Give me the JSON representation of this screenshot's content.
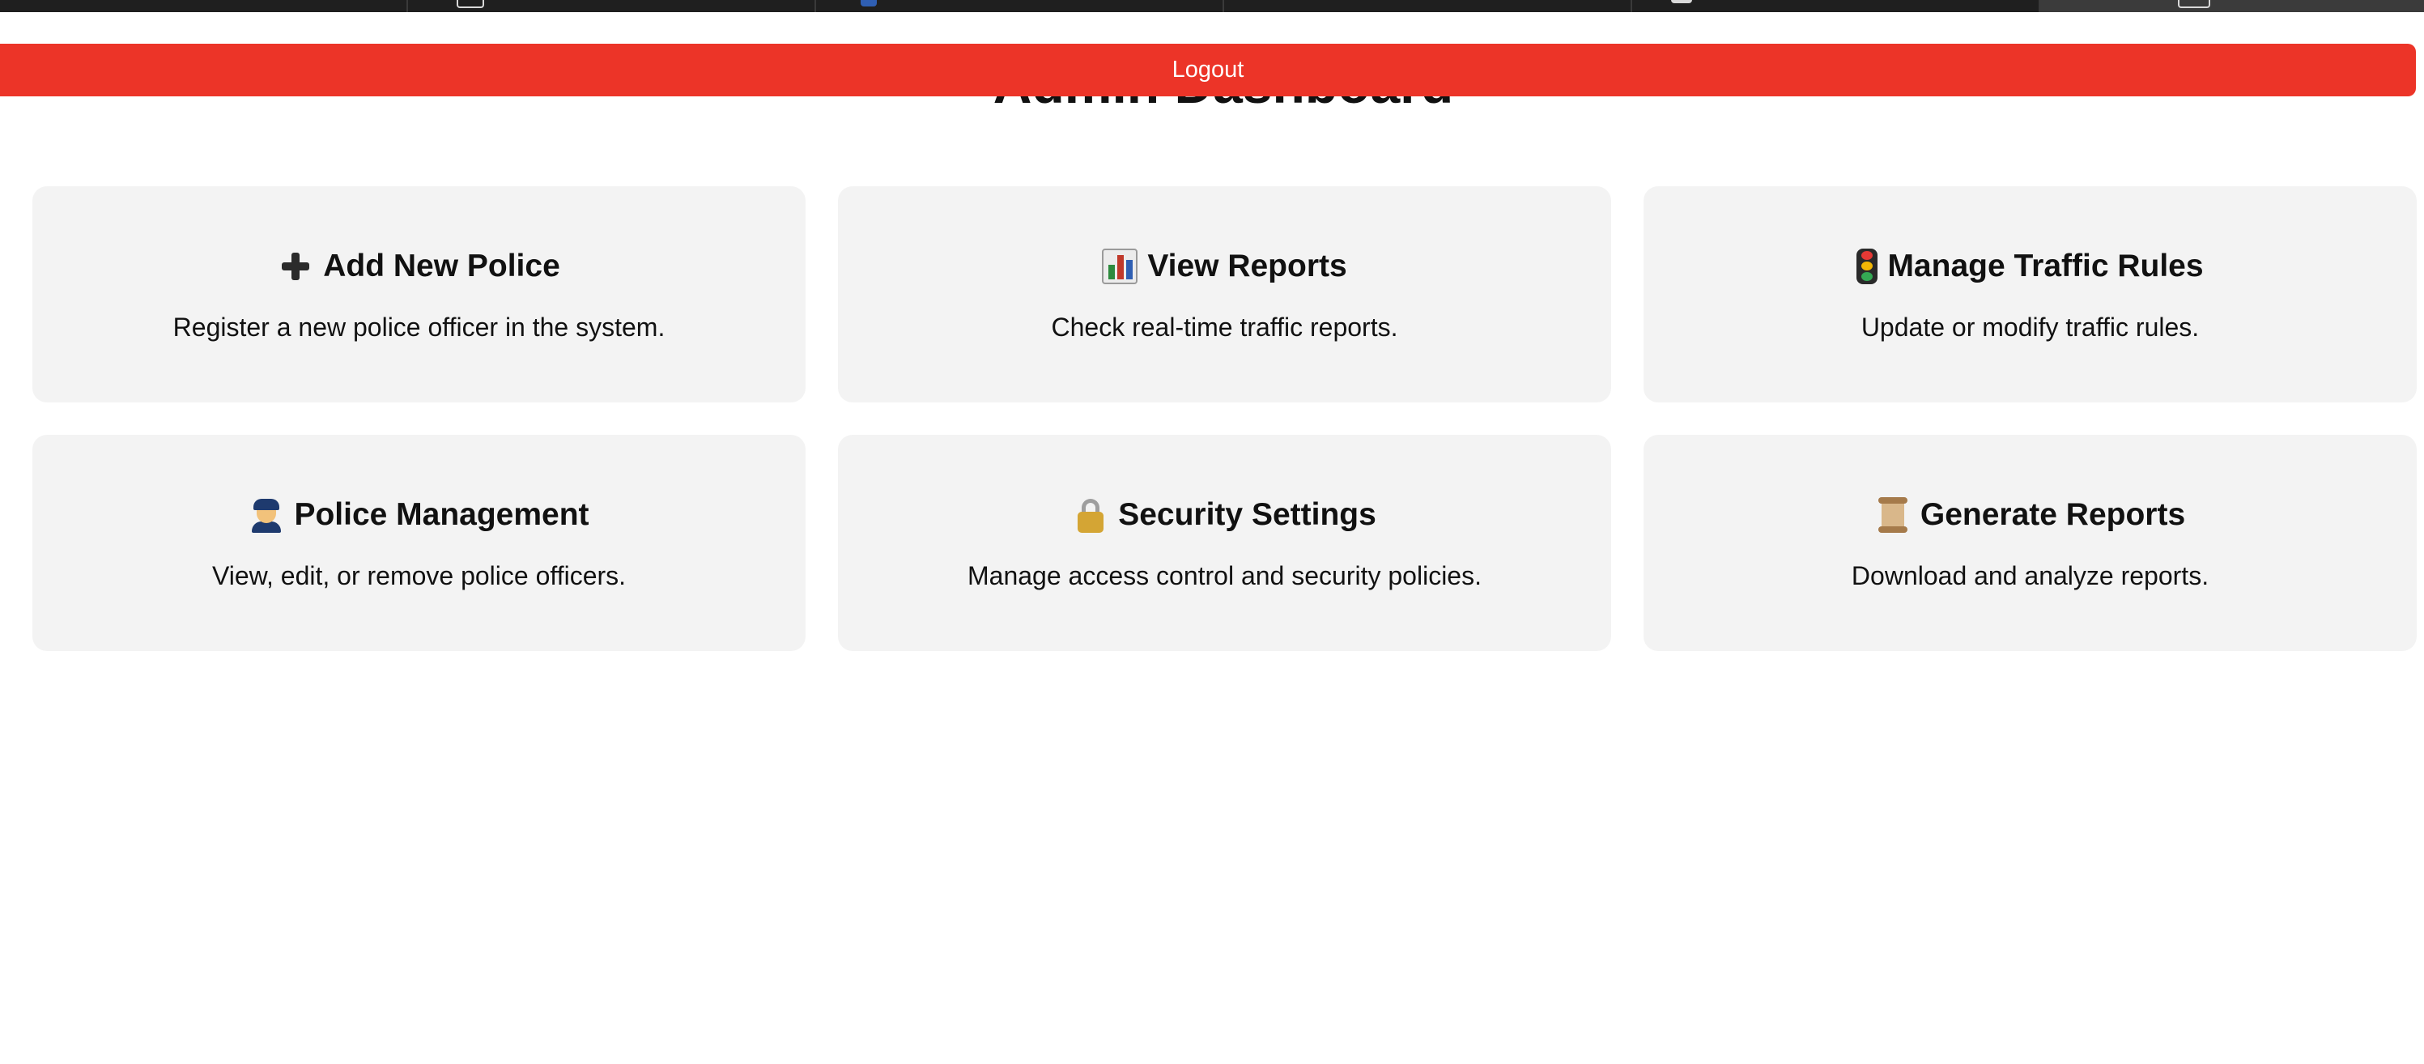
{
  "browser": {
    "tabs": [
      {
        "icon": "tab-favicon-icon"
      },
      {
        "icon": "tab-favicon-icon"
      },
      {
        "icon": "tab-favicon-icon"
      },
      {
        "icon": "tab-favicon-icon"
      },
      {
        "icon": "tab-favicon-icon"
      },
      {
        "icon": "tab-favicon-icon",
        "active": true
      }
    ]
  },
  "header": {
    "title": "Admin Dashboard",
    "logout_label": "Logout",
    "logout_color": "#ec3428"
  },
  "cards": [
    {
      "icon": "plus-icon",
      "title": "Add New Police",
      "description": "Register a new police officer in the system."
    },
    {
      "icon": "bar-chart-icon",
      "title": "View Reports",
      "description": "Check real-time traffic reports."
    },
    {
      "icon": "traffic-light-icon",
      "title": "Manage Traffic Rules",
      "description": "Update or modify traffic rules."
    },
    {
      "icon": "police-officer-icon",
      "title": "Police Management",
      "description": "View, edit, or remove police officers."
    },
    {
      "icon": "lock-icon",
      "title": "Security Settings",
      "description": "Manage access control and security policies."
    },
    {
      "icon": "scroll-icon",
      "title": "Generate Reports",
      "description": "Download and analyze reports."
    }
  ],
  "colors": {
    "card_background": "#f3f3f3",
    "tab_strip": "#1f1f1f"
  }
}
